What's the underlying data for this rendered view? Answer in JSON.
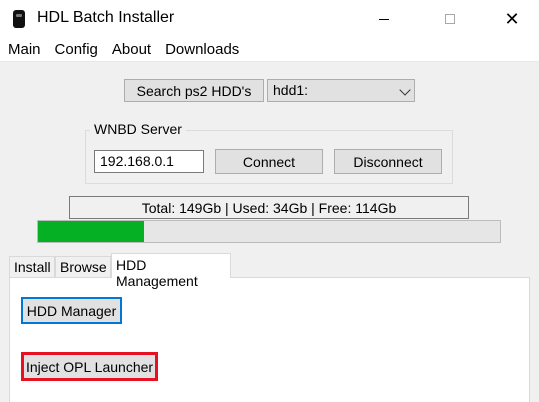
{
  "window": {
    "title": "HDL Batch Installer",
    "close_glyph": "✕"
  },
  "menu": [
    "Main",
    "Config",
    "About",
    "Downloads"
  ],
  "search": {
    "button_label": "Search ps2 HDD's",
    "selected_drive": "hdd1:"
  },
  "wnbd": {
    "group_title": "WNBD Server",
    "ip_value": "192.168.0.1",
    "connect_label": "Connect",
    "disconnect_label": "Disconnect"
  },
  "storage": {
    "status_text": "Total: 149Gb | Used: 34Gb | Free: 114Gb",
    "used_fraction": 0.23,
    "bar_color": "#06b025"
  },
  "tabs": [
    "Install",
    "Browse",
    "HDD Management"
  ],
  "active_tab": "HDD Management",
  "hdd_management": {
    "hdd_manager_label": "HDD Manager",
    "inject_label": "Inject OPL Launcher",
    "highlight_color": "#e81123"
  }
}
